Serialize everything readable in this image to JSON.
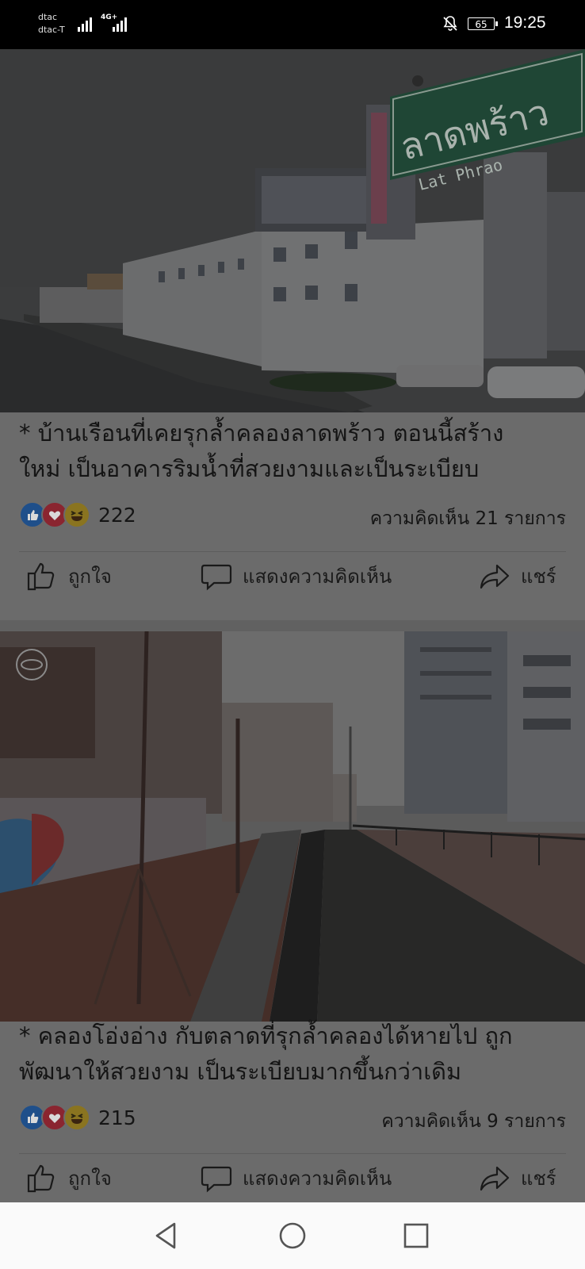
{
  "status_bar": {
    "carrier_1": "dtac",
    "carrier_2": "dtac-T",
    "network": "4G+",
    "battery": "65",
    "time": "19:25",
    "icons": [
      "signal-icon",
      "signal-icon",
      "bell-off-icon",
      "battery-icon"
    ]
  },
  "posts": [
    {
      "caption_line1": "* บ้านเรือนที่เคยรุกล้ำคลองลาดพร้าว ตอนนี้สร้าง",
      "caption_line2": "ใหม่ เป็นอาคารริมน้ำที่สวยงามและเป็นระเบียบ",
      "photo_sign_text": "ลาดพร้าว",
      "photo_sign_sub": "Lat Phrao",
      "reaction_count": "222",
      "comments": "ความคิดเห็น 21 รายการ",
      "like_label": "ถูกใจ",
      "comment_label": "แสดงความคิดเห็น",
      "share_label": "แชร์"
    },
    {
      "caption_line1": "* คลองโอ่งอ่าง กับตลาดที่รุกล้ำคลองได้หายไป ถูก",
      "caption_line2": "พัฒนาให้สวยงาม เป็นระเบียบมากขึ้นกว่าเดิม",
      "reaction_count": "215",
      "comments": "ความคิดเห็น 9 รายการ",
      "like_label": "ถูกใจ",
      "comment_label": "แสดงความคิดเห็น",
      "share_label": "แชร์"
    }
  ],
  "nav": {
    "icons": [
      "back-icon",
      "home-icon",
      "recents-icon"
    ]
  }
}
